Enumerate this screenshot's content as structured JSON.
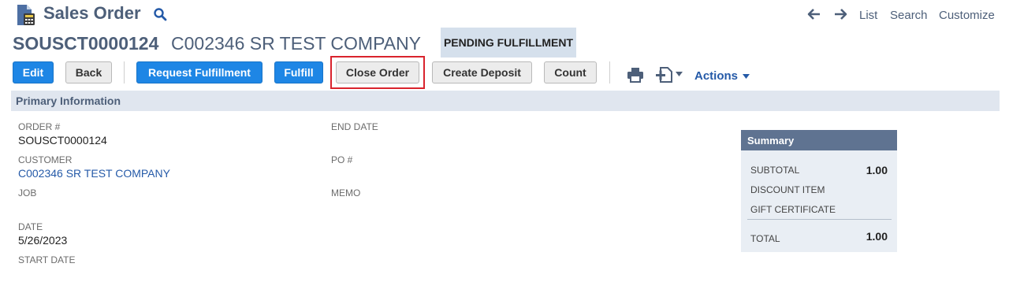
{
  "header": {
    "record_type": "Sales Order",
    "nav_links": [
      "List",
      "Search",
      "Customize"
    ]
  },
  "record": {
    "number": "SOUSCT0000124",
    "name": "C002346 SR TEST COMPANY",
    "status": "PENDING FULFILLMENT"
  },
  "toolbar": {
    "edit": "Edit",
    "back": "Back",
    "request_fulfillment": "Request Fulfillment",
    "fulfill": "Fulfill",
    "close_order": "Close Order",
    "create_deposit": "Create Deposit",
    "count": "Count",
    "actions": "Actions"
  },
  "section": {
    "title": "Primary Information"
  },
  "fields": {
    "order_no": {
      "label": "ORDER #",
      "value": "SOUSCT0000124"
    },
    "customer": {
      "label": "CUSTOMER",
      "value": "C002346 SR TEST COMPANY"
    },
    "job": {
      "label": "JOB",
      "value": ""
    },
    "date": {
      "label": "DATE",
      "value": "5/26/2023"
    },
    "start_date": {
      "label": "START DATE",
      "value": ""
    },
    "end_date": {
      "label": "END DATE",
      "value": ""
    },
    "po_no": {
      "label": "PO #",
      "value": ""
    },
    "memo": {
      "label": "MEMO",
      "value": ""
    }
  },
  "summary": {
    "title": "Summary",
    "subtotal_label": "SUBTOTAL",
    "subtotal_value": "1.00",
    "discount_label": "DISCOUNT ITEM",
    "gift_label": "GIFT CERTIFICATE",
    "total_label": "TOTAL",
    "total_value": "1.00"
  },
  "colors": {
    "primary_blue": "#1e86e5",
    "header_text": "#4d5f79",
    "link": "#255aa8",
    "highlight_border": "#d9232d",
    "section_bar": "#e0e6ef",
    "summary_header": "#5f7391"
  },
  "icons": [
    "record-type-icon",
    "search-icon",
    "back-arrow-icon",
    "forward-arrow-icon",
    "print-icon",
    "new-document-icon",
    "caret-down-icon"
  ]
}
